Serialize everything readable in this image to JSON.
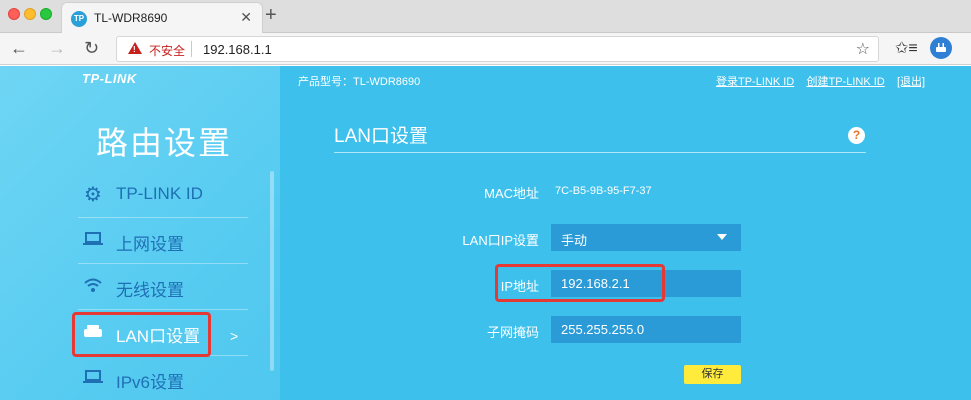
{
  "browser": {
    "tab_title": "TL-WDR8690",
    "tab_favicon": "TP",
    "tab_close": "✕",
    "new_tab": "+",
    "security_label": "不安全",
    "url": "192.168.1.1"
  },
  "header": {
    "logo": "TP-LINK",
    "model": "产品型号：TL-WDR8690",
    "links": {
      "login": "登录TP-LINK ID",
      "create": "创建TP-LINK ID",
      "logout": "[退出]"
    }
  },
  "sidebar": {
    "title": "路由设置",
    "items": [
      {
        "label": "TP-LINK ID",
        "icon": "gear-icon"
      },
      {
        "label": "上网设置",
        "icon": "laptop-icon"
      },
      {
        "label": "无线设置",
        "icon": "wifi-icon"
      },
      {
        "label": "LAN口设置",
        "icon": "router-icon",
        "active": true
      },
      {
        "label": "IPv6设置",
        "icon": "laptop-icon"
      }
    ],
    "active_arrow": ">"
  },
  "main": {
    "title": "LAN口设置",
    "help": "?",
    "mac_label": "MAC地址",
    "mac_value": "7C-B5-9B-95-F7-37",
    "lan_ip_setting_label": "LAN口IP设置",
    "lan_ip_setting_value": "手动",
    "ip_label": "IP地址",
    "ip_value": "192.168.2.1",
    "mask_label": "子网掩码",
    "mask_value": "255.255.255.0",
    "save_label": "保存"
  }
}
